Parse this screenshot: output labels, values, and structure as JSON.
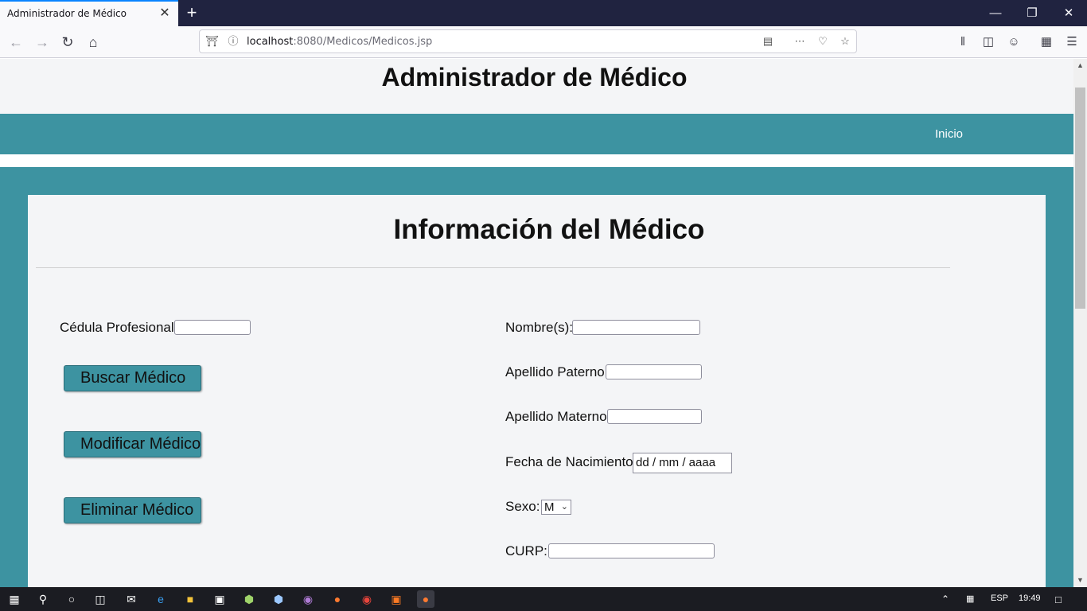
{
  "browser": {
    "tab_title": "Administrador de Médico",
    "url_host": "localhost",
    "url_rest": ":8080/Medicos/Medicos.jsp"
  },
  "page": {
    "title": "Administrador de Médico",
    "nav": {
      "inicio": "Inicio"
    },
    "section_title": "Información del Médico",
    "form": {
      "cedula_label": "Cédula Profesional:",
      "buscar_button": "Buscar Médico",
      "modificar_button": "Modificar Médico",
      "eliminar_button": "Eliminar Médico",
      "nombre_label": "Nombre(s):",
      "apellido_paterno_label": "Apellido Paterno:",
      "apellido_materno_label": "Apellido Materno:",
      "fecha_label": "Fecha de Nacimiento:",
      "fecha_placeholder": "dd / mm / aaaa",
      "sexo_label": "Sexo:",
      "sexo_value": "M",
      "curp_label": "CURP:"
    }
  },
  "taskbar": {
    "language": "ESP",
    "time": "19:49"
  },
  "colors": {
    "teal": "#3d93a1",
    "header_bg": "#f4f5f7",
    "tabbar_bg": "#202340",
    "taskbar_bg": "#1b1c22"
  }
}
